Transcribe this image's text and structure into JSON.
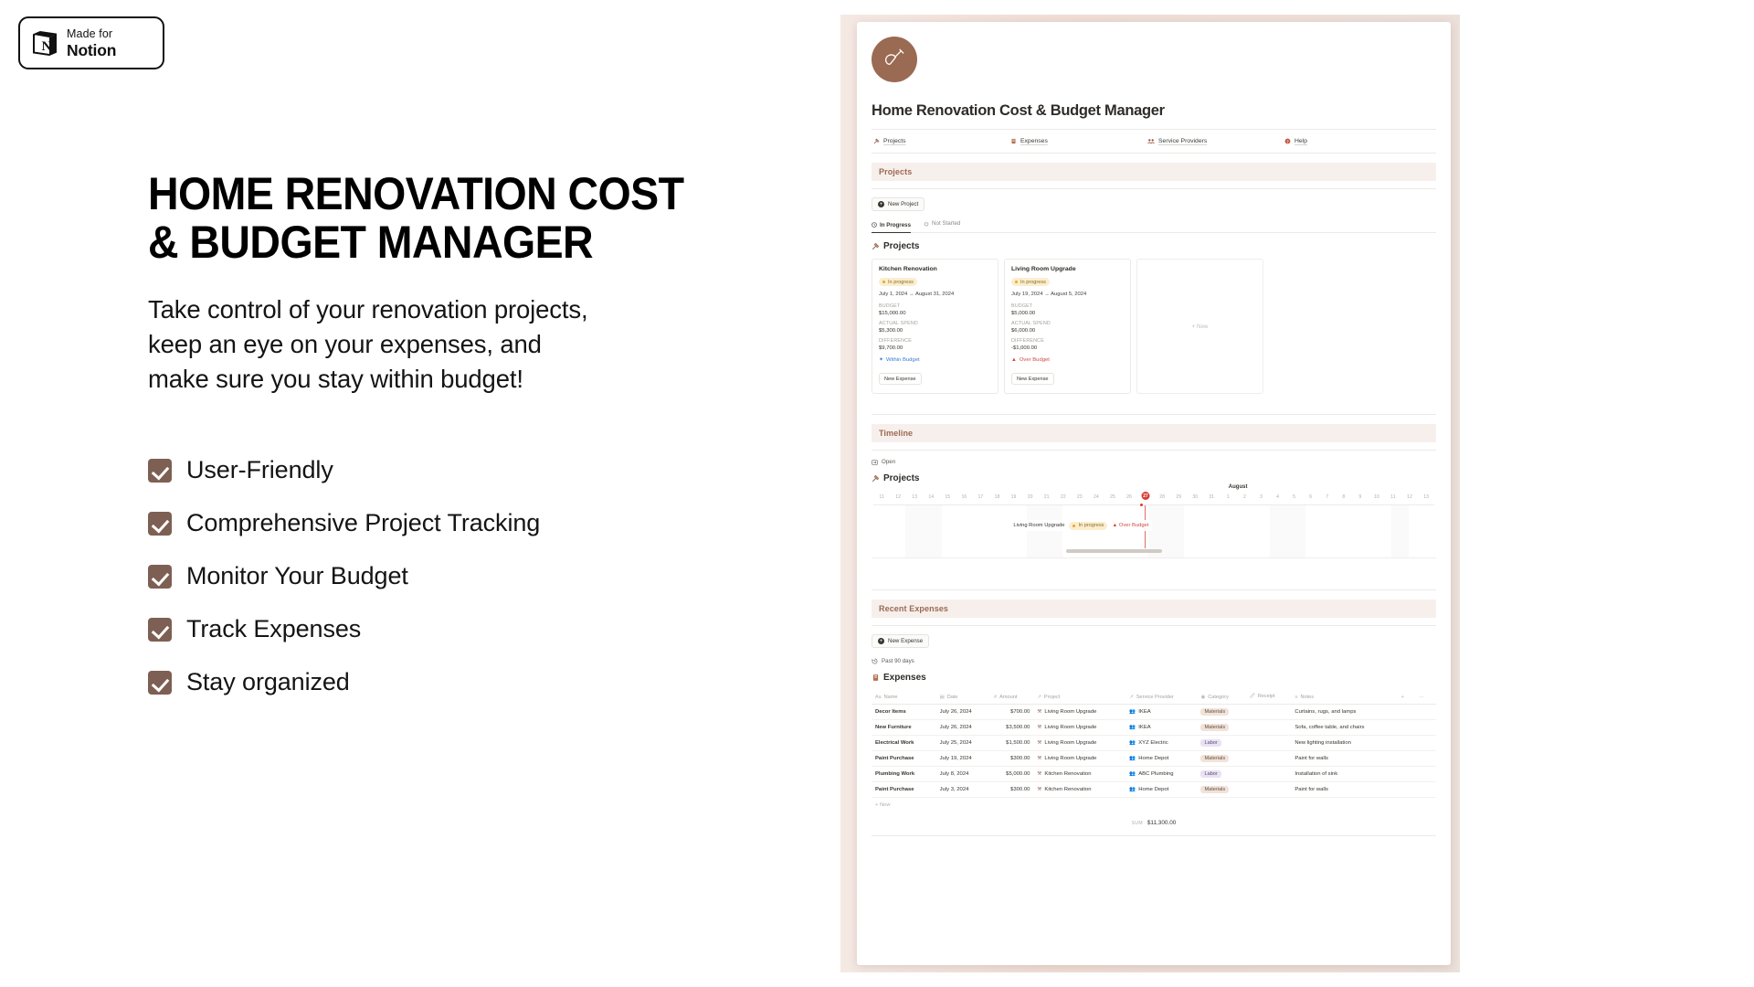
{
  "badge": {
    "made_for": "Made for",
    "brand": "Notion",
    "cube_icon": "notion-cube-icon"
  },
  "marketing": {
    "headline": "HOME RENOVATION COST\n& BUDGET MANAGER",
    "subheadline": "Take control of your renovation projects,\nkeep an eye on your expenses, and\nmake sure you stay within budget!",
    "features": [
      "User-Friendly",
      "Comprehensive Project Tracking",
      "Monitor Your Budget",
      "Track Expenses",
      "Stay organized"
    ],
    "checkbox_color": "#7d6053"
  },
  "app": {
    "icon": "trowel-icon",
    "icon_bg": "#9a6a53",
    "title": "Home Renovation Cost & Budget Manager",
    "nav": [
      {
        "label": "Projects",
        "icon": "hammer-icon"
      },
      {
        "label": "Expenses",
        "icon": "receipt-icon"
      },
      {
        "label": "Service Providers",
        "icon": "people-icon"
      },
      {
        "label": "Help",
        "icon": "question-icon"
      }
    ],
    "projects_section": {
      "band_label": "Projects",
      "new_button": "New Project",
      "tabs": [
        {
          "label": "In Progress",
          "icon": "clock-icon",
          "active": true
        },
        {
          "label": "Not Started",
          "icon": "power-icon",
          "active": false
        }
      ],
      "db_title": "Projects",
      "db_icon": "hammer-icon",
      "cards": [
        {
          "title": "Kitchen Renovation",
          "status": "In progress",
          "dates": "July 1, 2024 → August 31, 2024",
          "budget_label": "BUDGET",
          "budget": "$15,000.00",
          "spend_label": "ACTUAL SPEND",
          "spend": "$5,300.00",
          "difference_label": "DIFFERENCE",
          "difference": "$9,700.00",
          "budget_status": "Within Budget",
          "budget_status_type": "within",
          "button": "New Expense"
        },
        {
          "title": "Living Room Upgrade",
          "status": "In progress",
          "dates": "July 19, 2024 → August 5, 2024",
          "budget_label": "BUDGET",
          "budget": "$5,000.00",
          "spend_label": "ACTUAL SPEND",
          "spend": "$6,000.00",
          "difference_label": "DIFFERENCE",
          "difference": "-$1,000.00",
          "budget_status": "Over Budget",
          "budget_status_type": "over",
          "button": "New Expense"
        }
      ],
      "empty_card_label": "+ New"
    },
    "timeline_section": {
      "band_label": "Timeline",
      "open_label": "Open",
      "db_title": "Projects",
      "month_label": "August",
      "days": [
        "11",
        "12",
        "13",
        "14",
        "15",
        "16",
        "17",
        "18",
        "19",
        "20",
        "21",
        "22",
        "23",
        "24",
        "25",
        "26",
        "27",
        "28",
        "29",
        "30",
        "31",
        "1",
        "2",
        "3",
        "4",
        "5",
        "6",
        "7",
        "8",
        "9",
        "10",
        "11",
        "12",
        "13"
      ],
      "today": "27",
      "bar": {
        "label": "Living Room Upgrade",
        "status": "In progress",
        "budget_status": "Over Budget"
      }
    },
    "expenses_section": {
      "band_label": "Recent Expenses",
      "new_button": "New Expense",
      "filter_label": "Past 90 days",
      "db_title": "Expenses",
      "db_icon": "receipt-icon",
      "columns": [
        {
          "label": "Name",
          "icon": "text-icon"
        },
        {
          "label": "Date",
          "icon": "calendar-icon"
        },
        {
          "label": "Amount",
          "icon": "number-icon"
        },
        {
          "label": "Project",
          "icon": "relation-icon"
        },
        {
          "label": "Service Provider",
          "icon": "relation-icon"
        },
        {
          "label": "Category",
          "icon": "select-icon"
        },
        {
          "label": "Receipt",
          "icon": "attachment-icon"
        },
        {
          "label": "Notes",
          "icon": "text-multiline-icon"
        }
      ],
      "rows": [
        {
          "name": "Decor Items",
          "date": "July 26, 2024",
          "amount": "$700.00",
          "project": "Living Room Upgrade",
          "provider": "IKEA",
          "category": "Materials",
          "receipt": "",
          "notes": "Curtains, rugs, and lamps"
        },
        {
          "name": "New Furniture",
          "date": "July 26, 2024",
          "amount": "$3,500.00",
          "project": "Living Room Upgrade",
          "provider": "IKEA",
          "category": "Materials",
          "receipt": "",
          "notes": "Sofa, coffee table, and chairs"
        },
        {
          "name": "Electrical Work",
          "date": "July 25, 2024",
          "amount": "$1,500.00",
          "project": "Living Room Upgrade",
          "provider": "XYZ Electric",
          "category": "Labor",
          "receipt": "",
          "notes": "New lighting installation"
        },
        {
          "name": "Paint Purchase",
          "date": "July 19, 2024",
          "amount": "$300.00",
          "project": "Living Room Upgrade",
          "provider": "Home Depot",
          "category": "Materials",
          "receipt": "",
          "notes": "Paint for walls"
        },
        {
          "name": "Plumbing Work",
          "date": "July 8, 2024",
          "amount": "$5,000.00",
          "project": "Kitchen Renovation",
          "provider": "ABC Plumbing",
          "category": "Labor",
          "receipt": "",
          "notes": "Installation of sink"
        },
        {
          "name": "Paint Purchase",
          "date": "July 3, 2024",
          "amount": "$300.00",
          "project": "Kitchen Renovation",
          "provider": "Home Depot",
          "category": "Materials",
          "receipt": "",
          "notes": "Paint for walls"
        }
      ],
      "new_row_label": "+ New",
      "sum_label": "SUM",
      "sum_value": "$11,300.00"
    }
  }
}
